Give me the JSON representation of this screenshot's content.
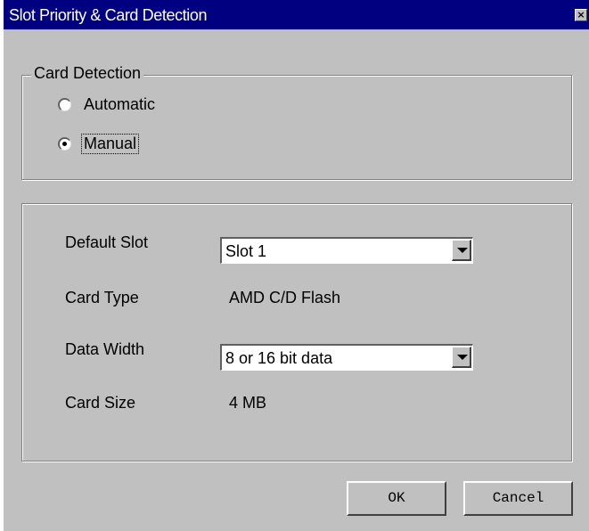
{
  "window": {
    "title": "Slot Priority & Card Detection",
    "close_glyph": "×"
  },
  "card_detection": {
    "legend": "Card Detection",
    "options": [
      {
        "label": "Automatic",
        "selected": false
      },
      {
        "label": "Manual",
        "selected": true
      }
    ]
  },
  "settings": {
    "default_slot": {
      "label": "Default Slot",
      "value": "Slot 1"
    },
    "card_type": {
      "label": "Card Type",
      "value": "AMD C/D Flash"
    },
    "data_width": {
      "label": "Data Width",
      "value": "8 or 16 bit data"
    },
    "card_size": {
      "label": "Card Size",
      "value": "4 MB"
    }
  },
  "buttons": {
    "ok_label": "OK",
    "cancel_label": "Cancel"
  },
  "colors": {
    "titlebar": "#000080",
    "dialog_face": "#c0c0c0"
  },
  "icons": {
    "close": "close-icon",
    "dropdown": "chevron-down-icon"
  }
}
